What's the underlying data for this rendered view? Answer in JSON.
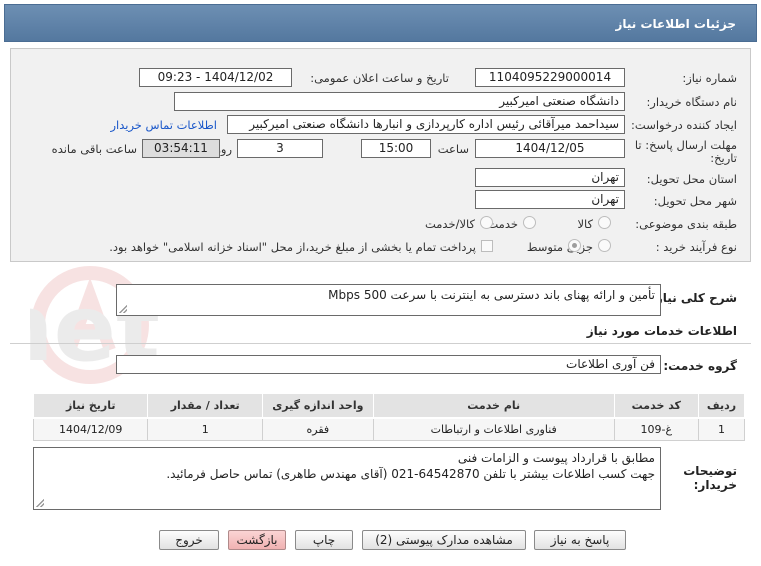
{
  "page": {
    "title": "جزئیات اطلاعات نیاز"
  },
  "fields": {
    "need_number_label": "شماره نیاز:",
    "need_number": "1104095229000014",
    "announce_label": "تاریخ و ساعت اعلان عمومی:",
    "announce_value": "1404/12/02 - 09:23",
    "buyer_org_label": "نام دستگاه خریدار:",
    "buyer_org": "دانشگاه صنعتی امیرکبیر",
    "creator_label": "ایجاد کننده درخواست:",
    "creator": "سیداحمد میرآقائی رئیس اداره کارپردازی و انبارها دانشگاه صنعتی امیرکبیر",
    "contact_link": "اطلاعات تماس خریدار",
    "deadline_label_1": "مهلت ارسال پاسخ: تا",
    "deadline_label_2": "تاریخ:",
    "deadline_date": "1404/12/05",
    "time_label": "ساعت",
    "deadline_time": "15:00",
    "days_value": "3",
    "days_label": "روز و",
    "remaining_time": "03:54:11",
    "remaining_label": "ساعت باقی مانده",
    "province_label": "استان محل تحویل:",
    "province": "تهران",
    "city_label": "شهر محل تحویل:",
    "city": "تهران",
    "category_label": "طبقه بندی موضوعی:",
    "category_options": [
      "کالا",
      "خدمت",
      "کالا/خدمت"
    ],
    "category_selected": "خدمت",
    "process_label": "نوع فرآیند خرید :",
    "process_options": [
      "جزیی",
      "متوسط"
    ],
    "process_selected": "جزیی",
    "payment_note": "پرداخت تمام یا بخشی از مبلغ خرید،از محل \"اسناد خزانه اسلامی\" خواهد بود."
  },
  "description": {
    "label": "شرح کلی نیاز:",
    "value": "تأمین و ارائه پهنای باند دسترسی به اینترنت با سرعت 500 Mbps"
  },
  "services": {
    "section_title": "اطلاعات خدمات مورد نیاز",
    "group_label": "گروه خدمت:",
    "group_value": "فن آوری اطلاعات",
    "columns": [
      "ردیف",
      "کد خدمت",
      "نام خدمت",
      "واحد اندازه گیری",
      "تعداد / مقدار",
      "تاریخ نیاز"
    ],
    "rows": [
      [
        "1",
        "غ-109",
        "فناوری اطلاعات و ارتباطات",
        "فقره",
        "1",
        "1404/12/09"
      ]
    ]
  },
  "notes": {
    "label_1": "توضیحات",
    "label_2": "خریدار:",
    "line_1": "مطابق با قرارداد پیوست و الزامات فنی",
    "line_2": "جهت کسب اطلاعات بیشتر با تلفن 64542870-021 (آقای مهندس طاهری) تماس حاصل فرمائید."
  },
  "buttons": {
    "reply": "پاسخ به نیاز",
    "attachments": "مشاهده مدارک پیوستی (2)",
    "print": "چاپ",
    "back": "بازگشت",
    "exit": "خروج"
  },
  "colors": {
    "header": "#5f81a6",
    "link": "#1a57c9",
    "pink_button": "#f4c1c1"
  }
}
